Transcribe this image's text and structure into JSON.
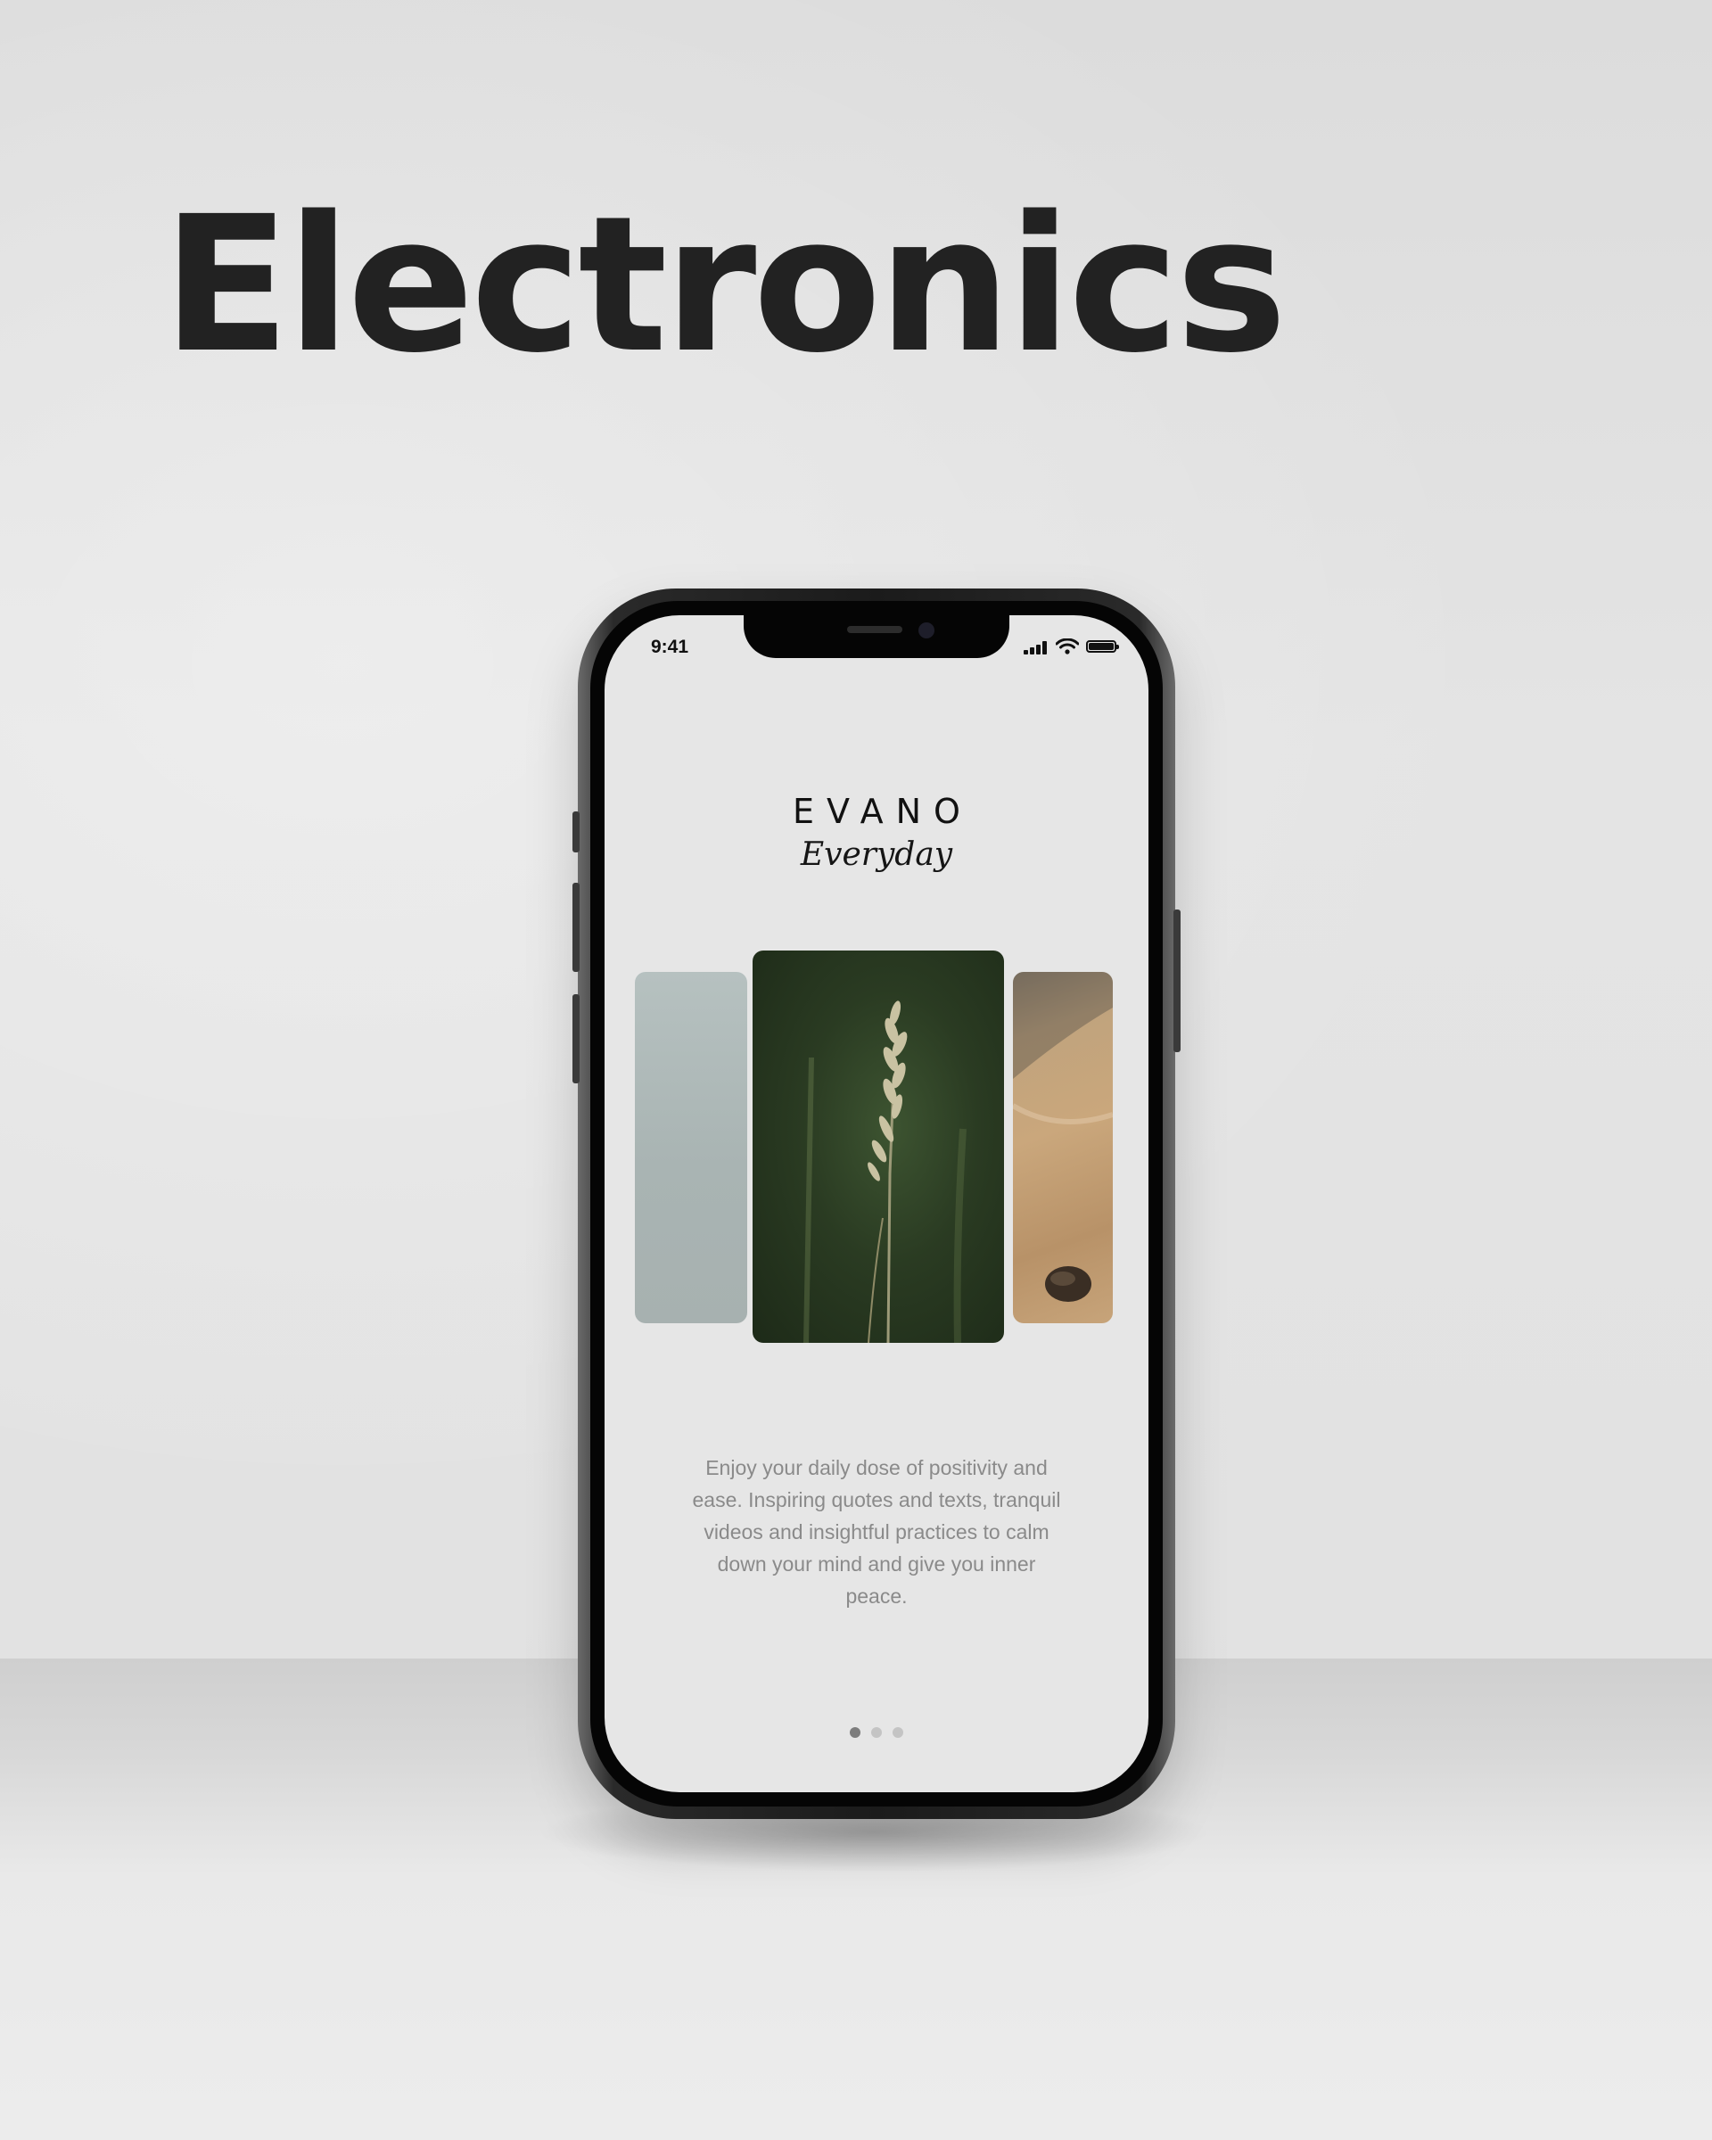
{
  "page": {
    "headline": "Electronics"
  },
  "phone": {
    "status_bar": {
      "time": "9:41",
      "icons": [
        "cellular-signal-icon",
        "wifi-icon",
        "battery-icon"
      ]
    },
    "app": {
      "brand_name": "EVANO",
      "brand_tagline": "Everyday",
      "carousel": {
        "cards": [
          "misty-sky-image",
          "wheat-grass-image",
          "sand-rock-image"
        ],
        "active_index": 1
      },
      "description": "Enjoy your daily dose of positivity and ease. Inspiring quotes and texts, tranquil videos and insightful practices to calm down your mind and give you inner peace.",
      "pagination": {
        "total": 3,
        "active_index": 0
      }
    }
  },
  "colors": {
    "background": "#e2e2e2",
    "headline": "#222222",
    "screen": "#e6e6e6",
    "description_text": "#8a8a8a",
    "dot_active": "#7d7d7d",
    "dot_inactive": "#c4c4c4"
  }
}
